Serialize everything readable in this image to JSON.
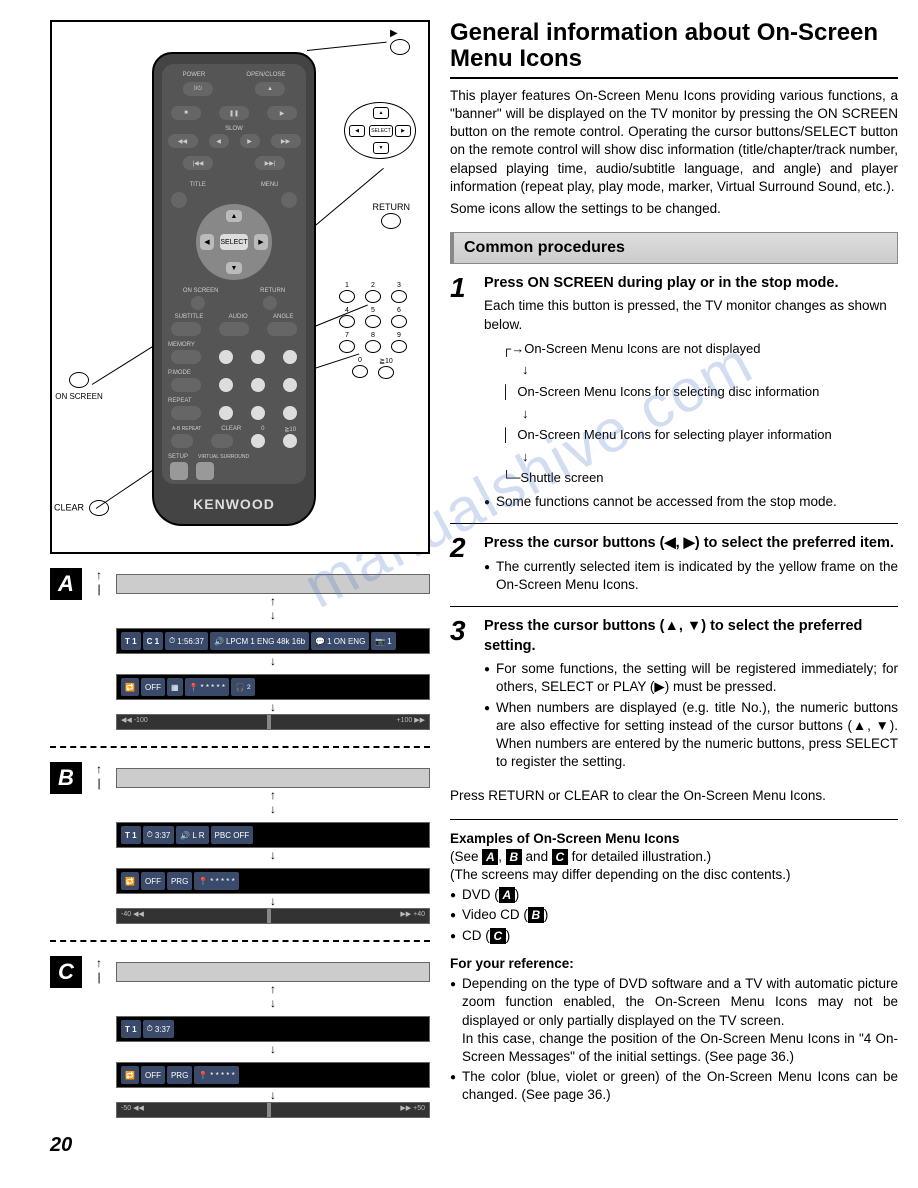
{
  "page_number": "20",
  "title": "General information about On-Screen Menu Icons",
  "intro_p1": "This player features On-Screen Menu Icons providing various functions, a \"banner\" will be displayed on the TV monitor by pressing the ON SCREEN button on the remote control. Operating the cursor buttons/SELECT button on the remote control will show disc information (title/chapter/track number, elapsed playing time, audio/subtitle language, and angle) and player information (repeat play, play mode, marker, Virtual Surround Sound, etc.).",
  "intro_p2": "Some icons allow the settings to be changed.",
  "section_label": "Common procedures",
  "steps": {
    "s1": {
      "num": "1",
      "title": "Press ON SCREEN during play or in the stop mode.",
      "p": "Each time this button is pressed, the TV monitor changes as shown below.",
      "cycle": [
        "On-Screen Menu Icons are not displayed",
        "On-Screen Menu Icons for selecting disc information",
        "On-Screen Menu Icons for selecting player information",
        "Shuttle screen"
      ],
      "note": "Some functions cannot be accessed from the stop mode."
    },
    "s2": {
      "num": "2",
      "title": "Press the cursor buttons (◀, ▶) to select the preferred item.",
      "bullets": [
        "The currently selected item is indicated by the yellow frame on the On-Screen Menu Icons."
      ]
    },
    "s3": {
      "num": "3",
      "title": "Press the cursor buttons (▲, ▼) to select the preferred setting.",
      "bullets": [
        "For some functions, the setting will be registered immediately; for others, SELECT or PLAY (▶) must be pressed.",
        "When numbers are displayed (e.g. title No.), the numeric buttons are also effective for setting instead of the cursor buttons (▲, ▼). When numbers are entered by the numeric buttons, press SELECT to register the setting."
      ]
    }
  },
  "return_note": "Press RETURN or CLEAR to clear the On-Screen Menu Icons.",
  "examples": {
    "heading": "Examples of On-Screen Menu Icons",
    "see_line_pre": "(See ",
    "see_line_post": " for detailed illustration.)",
    "letters": [
      "A",
      "B",
      "C"
    ],
    "note": "(The screens may differ depending on the disc contents.)",
    "items": [
      "DVD (A)",
      "Video CD (B)",
      "CD (C)"
    ]
  },
  "reference": {
    "heading": "For your reference:",
    "b1": "Depending on the type of DVD software and a TV with automatic picture zoom function enabled, the On-Screen Menu Icons may not be displayed or only partially displayed on the TV screen.",
    "b1b": "In this case, change the position of the On-Screen Menu Icons in \"4 On-Screen Messages\" of the initial settings. (See page 36.)",
    "b2": "The color (blue, violet or green) of the On-Screen Menu Icons can be changed. (See page 36.)"
  },
  "remote": {
    "brand": "KENWOOD",
    "labels": {
      "power": "POWER",
      "open_close": "OPEN/CLOSE",
      "slow": "SLOW",
      "title": "TITLE",
      "menu": "MENU",
      "select": "SELECT",
      "on_screen": "ON SCREEN",
      "return": "RETURN",
      "subtitle": "SUBTITLE",
      "audio": "AUDIO",
      "angle": "ANGLE",
      "memory": "MEMORY",
      "pmode": "P.MODE",
      "repeat": "REPEAT",
      "clear": "CLEAR",
      "ab_repeat": "A-B REPEAT",
      "virtual_surround": "VIRTUAL SURROUND",
      "setup": "SETUP"
    },
    "keypad": [
      "1",
      "2",
      "3",
      "4",
      "5",
      "6",
      "7",
      "8",
      "9",
      "0",
      "≧10"
    ],
    "callouts": {
      "play": "▶",
      "return": "RETURN",
      "on_screen": "ON SCREEN",
      "clear": "CLEAR"
    }
  },
  "osd": {
    "A": {
      "letter": "A",
      "row1": {
        "t": "T 1",
        "c": "C 1",
        "time": "1:56:37",
        "audio": "LPCM 1 ENG 48k 16b",
        "sub": "1 ON ENG",
        "angle": "1"
      },
      "row2": {
        "repeat": "OFF",
        "marker": "* * * * *",
        "vss": "2"
      },
      "shuttle": {
        "left": "-100",
        "right": "+100"
      }
    },
    "B": {
      "letter": "B",
      "row1": {
        "t": "T 1",
        "time": "3:37",
        "lr": "L R",
        "pbc": "PBC OFF"
      },
      "row2": {
        "repeat": "OFF",
        "mode": "PRG",
        "marker": "* * * * *"
      },
      "shuttle": {
        "left": "-40",
        "right": "+40"
      }
    },
    "C": {
      "letter": "C",
      "row1": {
        "t": "T 1",
        "time": "3:37"
      },
      "row2": {
        "repeat": "OFF",
        "mode": "PRG",
        "marker": "* * * * *"
      },
      "shuttle": {
        "left": "-50",
        "right": "+50"
      }
    }
  },
  "watermark": "manualshive.com"
}
